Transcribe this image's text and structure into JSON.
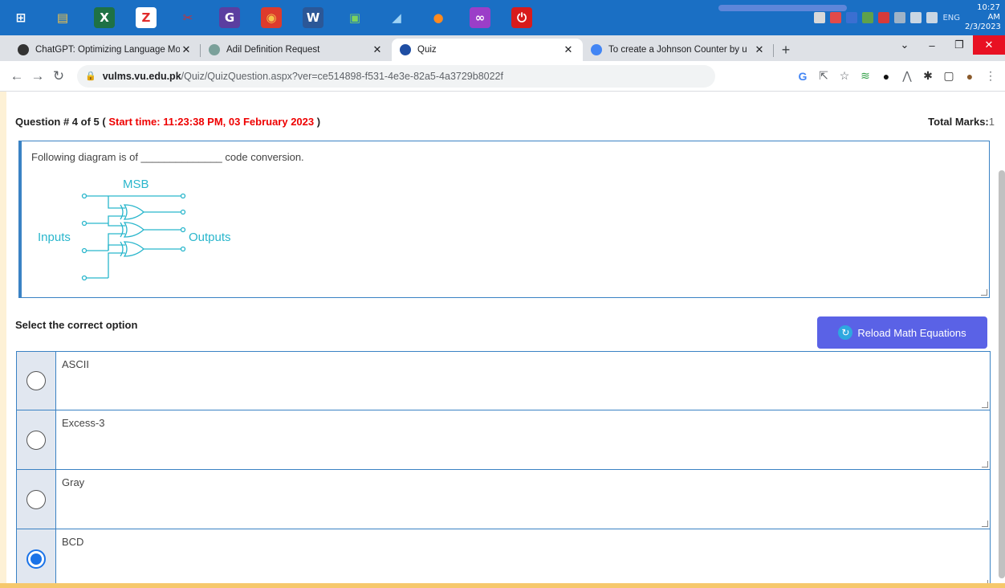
{
  "taskbar": {
    "icons": [
      {
        "name": "windows-start-icon",
        "glyph": "⊞",
        "color": "#ffffff",
        "bg": "transparent"
      },
      {
        "name": "file-explorer-icon",
        "glyph": "▤",
        "color": "#f3c44a",
        "bg": "transparent"
      },
      {
        "name": "excel-icon",
        "glyph": "X",
        "color": "#ffffff",
        "bg": "#1e7145"
      },
      {
        "name": "pdf-reader-icon",
        "glyph": "Z",
        "color": "#e12b2b",
        "bg": "#ffffff"
      },
      {
        "name": "snipping-tool-icon",
        "glyph": "✂",
        "color": "#d03030",
        "bg": "transparent"
      },
      {
        "name": "foxit-pdf-icon",
        "glyph": "G",
        "color": "#ffffff",
        "bg": "#5b3ea0"
      },
      {
        "name": "chrome-icon",
        "glyph": "◉",
        "color": "#f3c44a",
        "bg": "#dd3b2c",
        "active": true
      },
      {
        "name": "word-icon",
        "glyph": "W",
        "color": "#ffffff",
        "bg": "#2b5797"
      },
      {
        "name": "remote-desktop-icon",
        "glyph": "▣",
        "color": "#7bd35e",
        "bg": "transparent"
      },
      {
        "name": "notepad-icon",
        "glyph": "◢",
        "color": "#9fd3f5",
        "bg": "transparent"
      },
      {
        "name": "firefox-icon",
        "glyph": "●",
        "color": "#ff8a1f",
        "bg": "transparent"
      },
      {
        "name": "infinity-app-icon",
        "glyph": "∞",
        "color": "#ffffff",
        "bg": "#9b3ec8"
      },
      {
        "name": "logic-sim-icon",
        "glyph": "⏻",
        "color": "#ffffff",
        "bg": "#d81b1b"
      }
    ],
    "tray": {
      "lang": "ENG",
      "time": "10:27 AM",
      "date": "2/3/2023"
    }
  },
  "tabs": [
    {
      "title": "ChatGPT: Optimizing Language Mo",
      "favicon": "chatgpt-icon",
      "fav_color": "#333333",
      "active": false
    },
    {
      "title": "Adil Definition Request",
      "favicon": "chatgpt-icon",
      "fav_color": "#7aa09a",
      "active": false
    },
    {
      "title": "Quiz",
      "favicon": "vu-logo-icon",
      "fav_color": "#1f4ea3",
      "active": true
    },
    {
      "title": "To create a Johnson Counter by u",
      "favicon": "google-icon",
      "fav_color": "#4285f4",
      "active": false
    }
  ],
  "address": {
    "host": "vulms.vu.edu.pk",
    "path": "/Quiz/QuizQuestion.aspx?ver=ce514898-f531-4e3e-82a5-4a3729b8022f"
  },
  "quiz": {
    "question_label": "Question # 4 of 5",
    "start_time": "Start time: 11:23:38 PM, 03 February 2023",
    "total_marks_label": "Total Marks:",
    "total_marks": "1",
    "question_text": "Following diagram is of ______________ code conversion.",
    "diagram": {
      "msb_label": "MSB",
      "inputs_label": "Inputs",
      "outputs_label": "Outputs",
      "color": "#29b6cc"
    },
    "select_label": "Select the correct option",
    "reload_label": "Reload Math Equations",
    "options": [
      {
        "label": "ASCII",
        "selected": false
      },
      {
        "label": "Excess-3",
        "selected": false
      },
      {
        "label": "Gray",
        "selected": false
      },
      {
        "label": "BCD",
        "selected": true
      }
    ]
  }
}
